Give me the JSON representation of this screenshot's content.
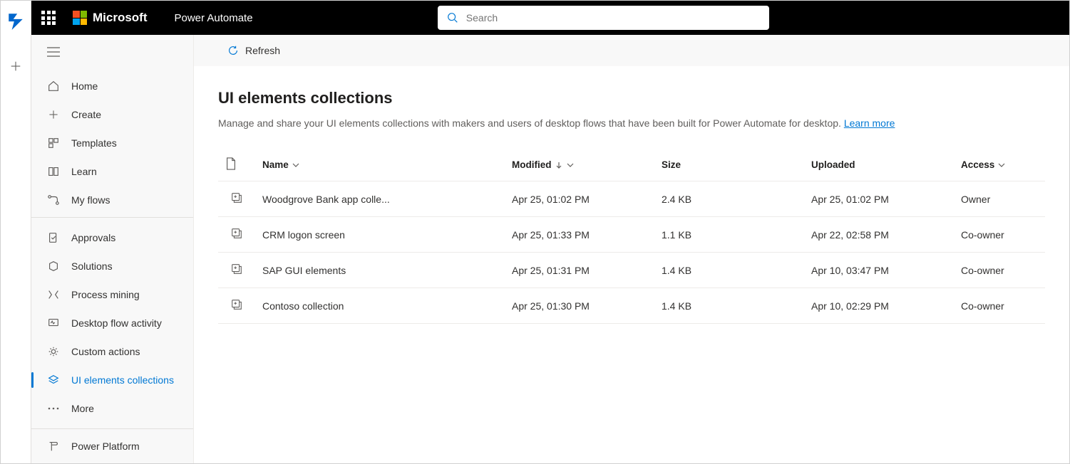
{
  "header": {
    "brand": "Microsoft",
    "appName": "Power Automate",
    "searchPlaceholder": "Search"
  },
  "commandbar": {
    "refresh": "Refresh"
  },
  "sidenav": {
    "home": "Home",
    "create": "Create",
    "templates": "Templates",
    "learn": "Learn",
    "myflows": "My flows",
    "approvals": "Approvals",
    "solutions": "Solutions",
    "processmining": "Process mining",
    "desktopflowactivity": "Desktop flow activity",
    "customactions": "Custom actions",
    "uielements": "UI elements collections",
    "more": "More",
    "powerplatform": "Power Platform"
  },
  "page": {
    "title": "UI elements collections",
    "description": "Manage and share your UI elements collections with makers and users of desktop flows that have been built for Power Automate for desktop. ",
    "learnMore": "Learn more"
  },
  "table": {
    "headers": {
      "name": "Name",
      "modified": "Modified",
      "size": "Size",
      "uploaded": "Uploaded",
      "access": "Access"
    },
    "rows": [
      {
        "name": "Woodgrove Bank app colle...",
        "modified": "Apr 25, 01:02 PM",
        "size": "2.4 KB",
        "uploaded": "Apr 25, 01:02 PM",
        "access": "Owner"
      },
      {
        "name": "CRM logon screen",
        "modified": "Apr 25, 01:33 PM",
        "size": "1.1 KB",
        "uploaded": "Apr 22, 02:58 PM",
        "access": "Co-owner"
      },
      {
        "name": "SAP GUI elements",
        "modified": "Apr 25, 01:31 PM",
        "size": "1.4 KB",
        "uploaded": "Apr 10, 03:47 PM",
        "access": "Co-owner"
      },
      {
        "name": "Contoso collection",
        "modified": "Apr 25, 01:30 PM",
        "size": "1.4 KB",
        "uploaded": "Apr 10, 02:29 PM",
        "access": "Co-owner"
      }
    ]
  }
}
